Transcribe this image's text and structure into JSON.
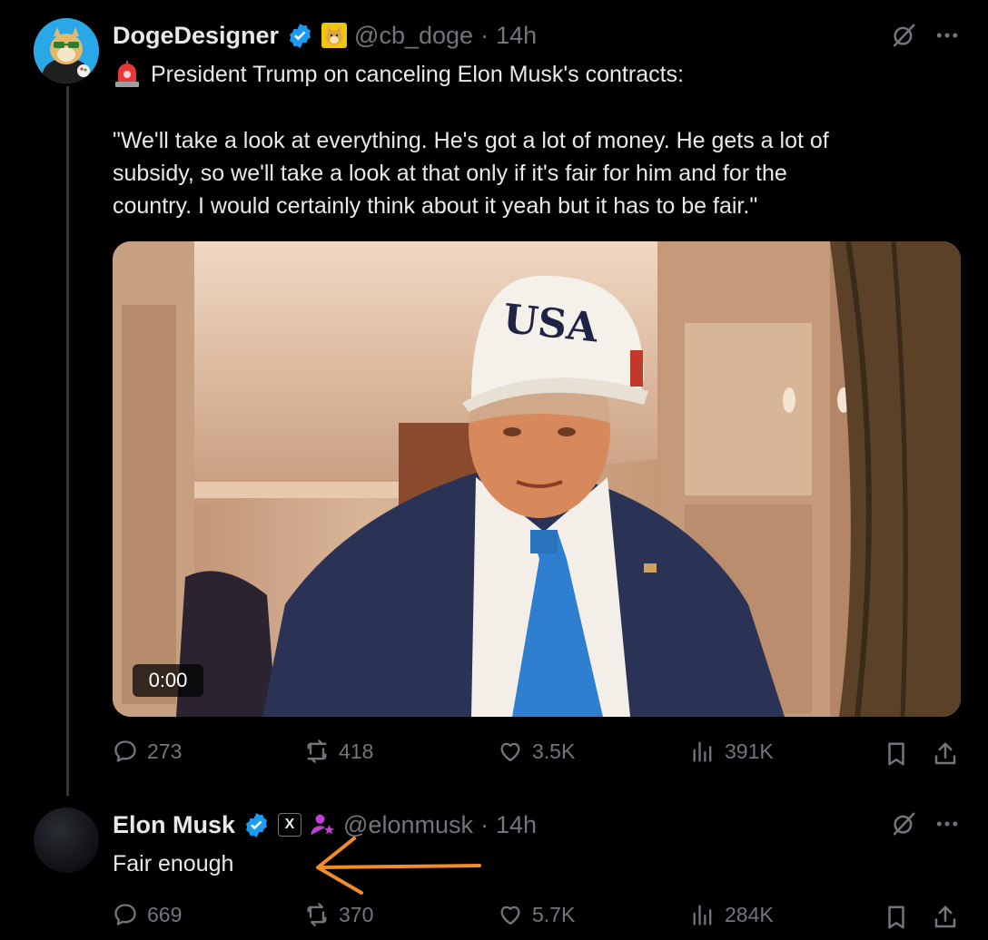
{
  "post1": {
    "author_name": "DogeDesigner",
    "handle": "@cb_doge",
    "separator": "·",
    "time": "14h",
    "text_line1": "President Trump on canceling Elon Musk's contracts:",
    "quote_line1": "\"We'll take a look at everything. He's got a lot of money. He gets a lot of",
    "quote_line2": "subsidy, so we'll take a look at that only if it's fair for him and for the",
    "quote_line3": "country. I would certainly think about it yeah but it has to be fair.\"",
    "video": {
      "timer": "0:00",
      "cap_text": "USA"
    },
    "actions": {
      "replies": "273",
      "reposts": "418",
      "likes": "3.5K",
      "views": "391K"
    }
  },
  "post2": {
    "author_name": "Elon Musk",
    "affiliate_badge": "X",
    "handle": "@elonmusk",
    "separator": "·",
    "time": "14h",
    "text": "Fair enough",
    "actions": {
      "replies": "669",
      "reposts": "370",
      "likes": "5.7K",
      "views": "284K"
    }
  },
  "colors": {
    "background": "#000000",
    "text": "#e7e9ea",
    "muted": "#71767b",
    "verified": "#1d9bf0",
    "annotation_arrow": "#f28c28"
  },
  "icons": [
    "verified-badge-icon",
    "doge-emoji-icon",
    "siren-emoji-icon",
    "grok-icon",
    "more-icon",
    "reply-icon",
    "repost-icon",
    "like-icon",
    "views-icon",
    "bookmark-icon",
    "share-icon",
    "x-affiliate-icon",
    "bio-person-icon"
  ]
}
